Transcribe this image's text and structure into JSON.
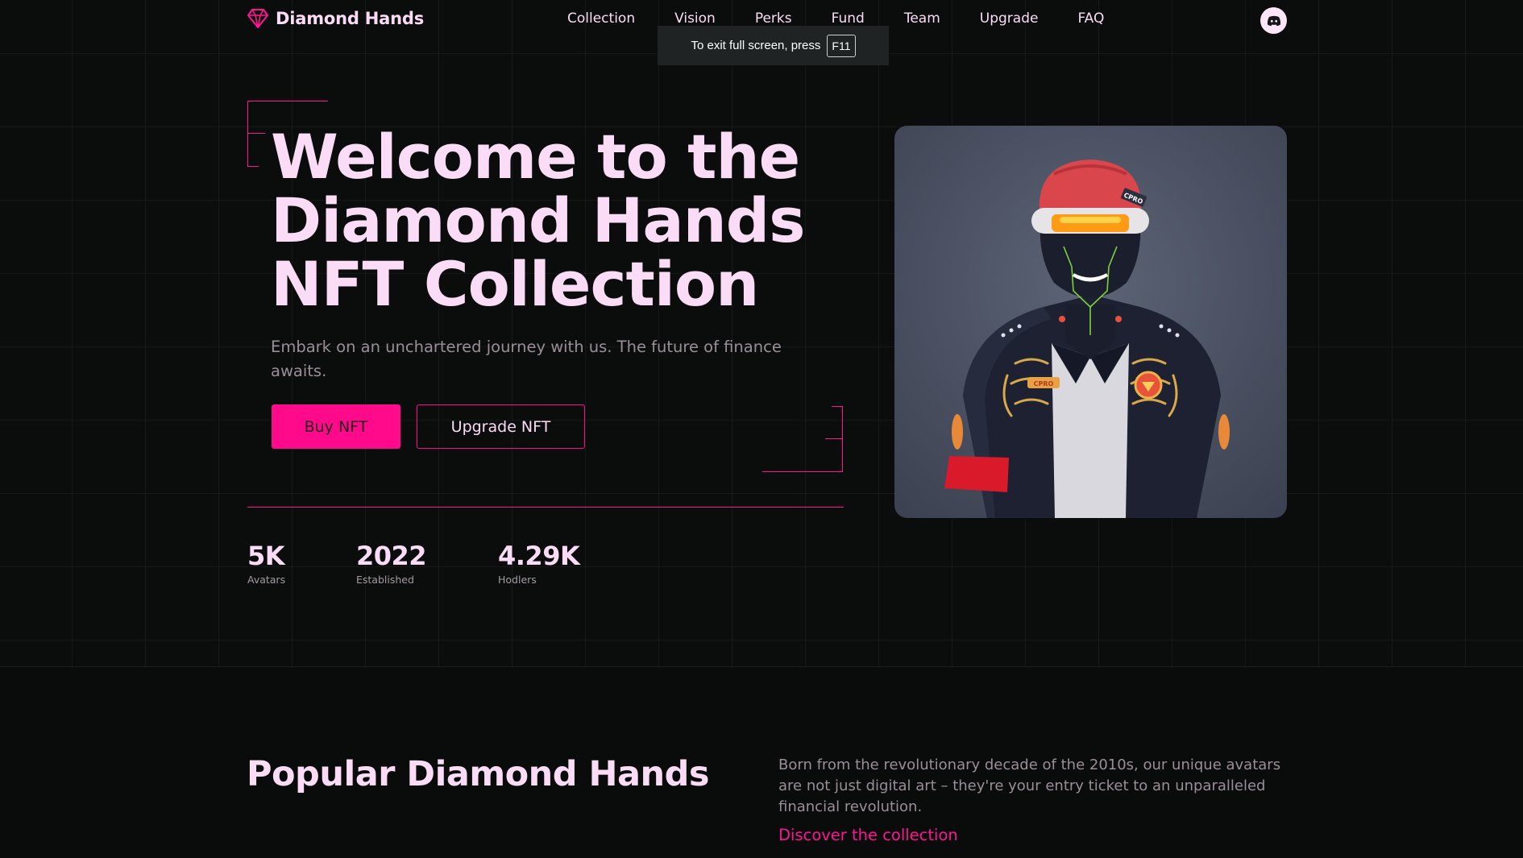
{
  "brand": {
    "name": "Diamond Hands",
    "logo_icon": "diamond-icon",
    "accent": "#ff0a8b"
  },
  "nav": {
    "items": [
      "Collection",
      "Vision",
      "Perks",
      "Fund",
      "Team",
      "Upgrade",
      "FAQ"
    ],
    "discord_icon": "discord-icon"
  },
  "fullscreen_toast": {
    "text": "To exit full screen, press",
    "key": "F11"
  },
  "hero": {
    "title_lines": [
      "Welcome to the",
      "Diamond Hands",
      "NFT Collection"
    ],
    "subtitle": "Embark on an unchartered journey with us. The future of finance awaits.",
    "buy_label": "Buy NFT",
    "upgrade_label": "Upgrade NFT",
    "stats": [
      {
        "value": "5K",
        "label": "Avatars"
      },
      {
        "value": "2022",
        "label": "Established"
      },
      {
        "value": "4.29K",
        "label": "Hodlers"
      }
    ],
    "cap_badge_text": "CPRO",
    "chest_badge_text": "CPRO"
  },
  "popular": {
    "title": "Popular Diamond Hands",
    "description": "Born from the revolutionary decade of the 2010s, our unique avatars are not just digital art – they're your entry ticket to an unparalleled financial revolution.",
    "link": "Discover the collection"
  }
}
